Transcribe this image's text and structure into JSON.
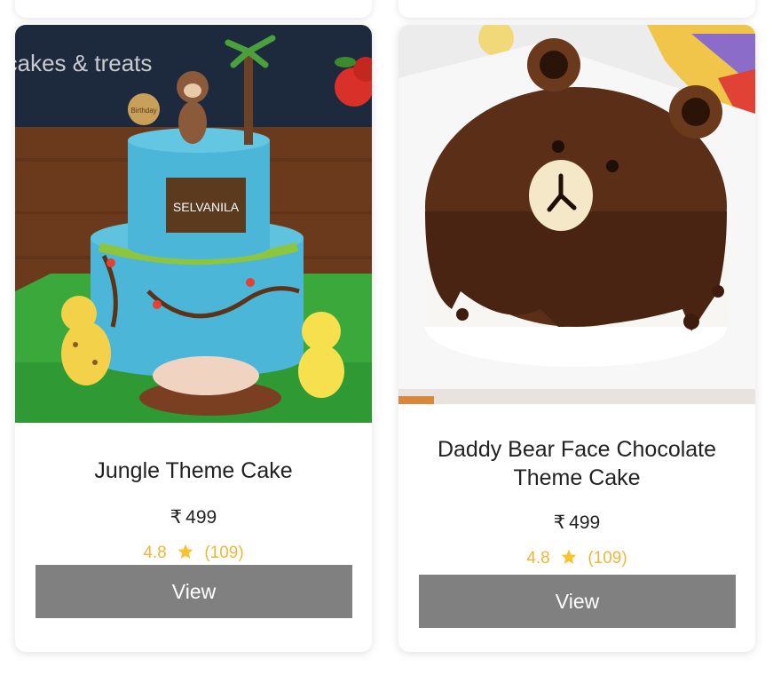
{
  "products": [
    {
      "title": "Jungle Theme Cake",
      "currency": "₹",
      "price": "499",
      "rating": "4.8",
      "reviews": "(109)",
      "button_label": "View",
      "image": {
        "brand_watermark": "cakes & treats",
        "plaque_text": "SELVANILA",
        "topper_text": "Birthday"
      }
    },
    {
      "title": "Daddy Bear Face Chocolate Theme Cake",
      "currency": "₹",
      "price": "499",
      "rating": "4.8",
      "reviews": "(109)",
      "button_label": "View",
      "image": {}
    }
  ],
  "colors": {
    "rating": "#f2b53a",
    "button": "#808080",
    "text": "#222222"
  },
  "icons": {
    "rating": "star-icon"
  }
}
